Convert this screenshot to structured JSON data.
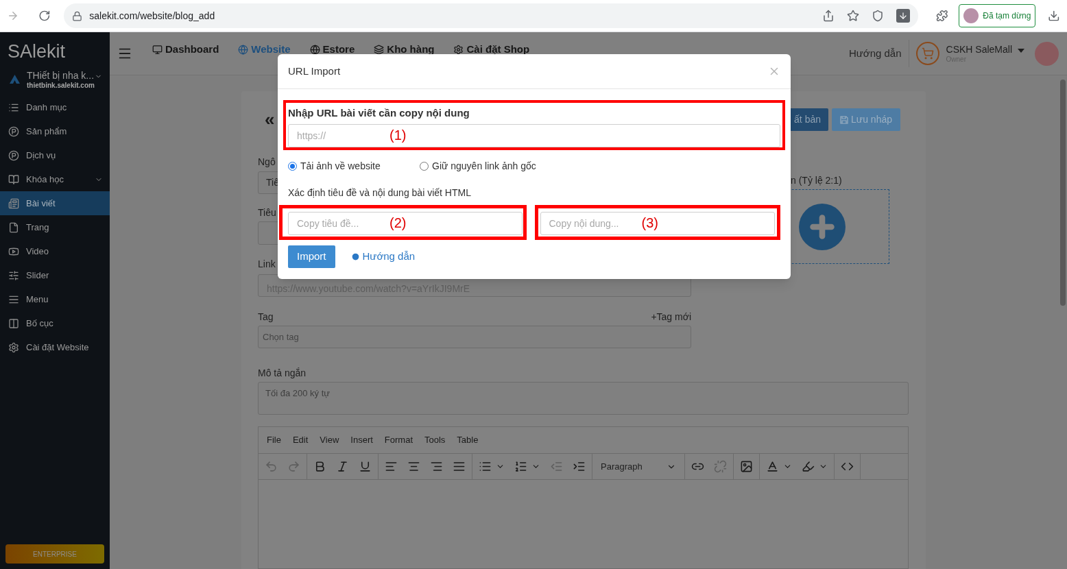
{
  "browser": {
    "url": "salekit.com/website/blog_add",
    "profile_status": "Đã tạm dừng"
  },
  "sidebar": {
    "logo": "SAlekit",
    "site": {
      "name": "THiết bị nha k...",
      "domain": "thietbink.salekit.com"
    },
    "items": [
      {
        "label": "Danh mục",
        "kind": "list",
        "selected": false,
        "expandable": false
      },
      {
        "label": "Sản phẩm",
        "kind": "badge",
        "selected": false,
        "expandable": false
      },
      {
        "label": "Dịch vụ",
        "kind": "badge",
        "selected": false,
        "expandable": false
      },
      {
        "label": "Khóa học",
        "kind": "book",
        "selected": false,
        "expandable": true
      },
      {
        "label": "Bài viết",
        "kind": "news",
        "selected": true,
        "expandable": false
      },
      {
        "label": "Trang",
        "kind": "file",
        "selected": false,
        "expandable": false
      },
      {
        "label": "Video",
        "kind": "video",
        "selected": false,
        "expandable": false
      },
      {
        "label": "Slider",
        "kind": "sliders",
        "selected": false,
        "expandable": false
      },
      {
        "label": "Menu",
        "kind": "menu",
        "selected": false,
        "expandable": false
      },
      {
        "label": "Bố cục",
        "kind": "columns",
        "selected": false,
        "expandable": false
      },
      {
        "label": "Cài đặt Website",
        "kind": "gear",
        "selected": false,
        "expandable": false
      }
    ],
    "plan": "ENTERPRISE"
  },
  "header": {
    "nav": [
      {
        "label": "Dashboard",
        "kind": "monitor",
        "selected": false
      },
      {
        "label": "Website",
        "kind": "globe",
        "selected": true
      },
      {
        "label": "Estore",
        "kind": "globe",
        "selected": false
      },
      {
        "label": "Kho hàng",
        "kind": "layers",
        "selected": false
      },
      {
        "label": "Cài đặt Shop",
        "kind": "gear",
        "selected": false
      }
    ],
    "help": "Hướng dẫn",
    "account": {
      "name": "CSKH SaleMall",
      "role": "Owner"
    }
  },
  "page": {
    "back": "«",
    "actions": [
      {
        "label": "ất bản",
        "kind": "publish"
      },
      {
        "label": "Lưu nháp",
        "kind": "draft"
      }
    ],
    "language_label": "Ngô",
    "language_value": "Tiê",
    "title_label": "Tiêu",
    "link_label": "Link",
    "link_placeholder": "https://www.youtube.com/watch?v=aYrIkJI9MrE",
    "tag_label": "Tag",
    "new_tag": "+Tag mới",
    "tag_placeholder": "Chọn tag",
    "summary_label": "Mô tả ngắn",
    "summary_placeholder": "Tối đa 200 ký tự",
    "image_label": "n (Tỷ lệ 2:1)"
  },
  "editor": {
    "menu": [
      "File",
      "Edit",
      "View",
      "Insert",
      "Format",
      "Tools",
      "Table"
    ],
    "toolbar": [
      [
        {
          "kind": "undo",
          "disabled": true
        },
        {
          "kind": "redo",
          "disabled": true
        }
      ],
      [
        {
          "kind": "bold",
          "disabled": false
        },
        {
          "kind": "italic",
          "disabled": false
        },
        {
          "kind": "underline",
          "disabled": false
        }
      ],
      [
        {
          "kind": "align_left",
          "disabled": false
        },
        {
          "kind": "align_center",
          "disabled": false
        },
        {
          "kind": "align_right",
          "disabled": false
        },
        {
          "kind": "justify",
          "disabled": false
        }
      ],
      [
        {
          "kind": "bullets",
          "disabled": false
        },
        {
          "kind": "numbers",
          "disabled": false
        },
        {
          "kind": "outdent",
          "disabled": true
        },
        {
          "kind": "indent",
          "disabled": false
        }
      ],
      [
        {
          "kind": "format",
          "label": "Paragraph",
          "disabled": false
        }
      ],
      [
        {
          "kind": "link",
          "disabled": false
        },
        {
          "kind": "unlink",
          "disabled": true
        }
      ],
      [
        {
          "kind": "image",
          "disabled": false
        }
      ],
      [
        {
          "kind": "text_color",
          "disabled": false
        },
        {
          "kind": "highlight",
          "disabled": false
        }
      ],
      [
        {
          "kind": "code",
          "disabled": false
        }
      ]
    ]
  },
  "modal": {
    "title": "URL Import",
    "url_label": "Nhập URL bài viết cần copy nội dung",
    "url_placeholder": "https://",
    "url_marker": "(1)",
    "image_options": [
      {
        "label": "Tải ảnh về website",
        "selected": true
      },
      {
        "label": "Giữ nguyên link ảnh gốc",
        "selected": false
      }
    ],
    "html_label": "Xác định tiêu đề và nội dung bài viết HTML",
    "title_placeholder": "Copy tiêu đề...",
    "title_marker": "(2)",
    "content_placeholder": "Copy nội dung...",
    "content_marker": "(3)",
    "import": "Import",
    "guide": "Hướng dẫn"
  }
}
